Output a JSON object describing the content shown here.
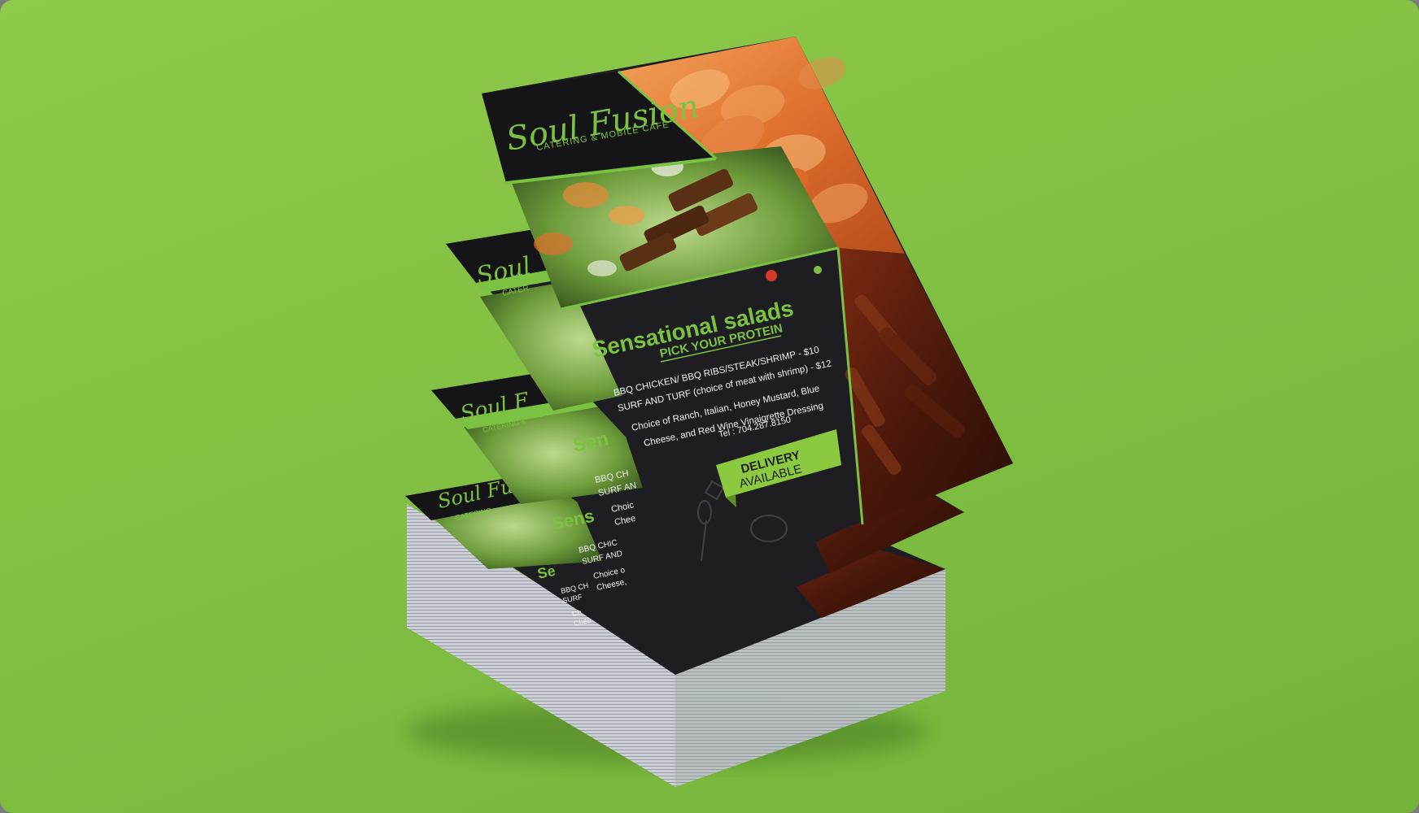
{
  "flyer": {
    "brand_name": "Soul Fusion",
    "brand_tagline": "CATERING & MOBILE CAFE",
    "headline": "Sensational salads",
    "subheadline": "PICK YOUR PROTEIN",
    "menu_line_1": "BBQ CHICKEN/ BBQ RIBS/STEAK/SHRIMP - $10",
    "menu_line_2": "SURF AND TURF (choice of meat with shrimp) - $12",
    "dressing_line_1": "Choice of Ranch, Italian, Honey Mustard, Blue",
    "dressing_line_2": "Cheese, and Red Wine Vinaigrette Dressing",
    "phone": "Tel : 704.287.8150",
    "badge_line_1": "DELIVERY",
    "badge_line_2": "AVAILABLE",
    "partial_headline_2": "Sen",
    "partial_headline_3": "Sens",
    "partial_headline_4": "Se",
    "partial_menu_2a": "BBQ CH",
    "partial_menu_2b": "SURF AN",
    "partial_dress_2a": "Choic",
    "partial_dress_2b": "Chee",
    "partial_menu_3a": "BBQ CHIC",
    "partial_menu_3b": "SURF AND",
    "partial_dress_3a": "Choice o",
    "partial_dress_3b": "Cheese,",
    "partial_menu_4a": "BBQ CH",
    "partial_menu_4b": "SURF",
    "partial_dress_4a": "Ch",
    "partial_dress_4b": "Chee",
    "partial_brand_2": "Soul",
    "partial_tag_2": "CATER",
    "partial_brand_3": "Soul F",
    "partial_tag_3": "CATERING &",
    "partial_brand_4": "Soul Fu",
    "partial_tag_4": "CATERING"
  },
  "colors": {
    "background": "#82c043",
    "flyer_dark": "#1e1e22",
    "accent_green": "#7cc242",
    "badge_green": "#8bc93f",
    "text_light": "#f2f2f2"
  }
}
